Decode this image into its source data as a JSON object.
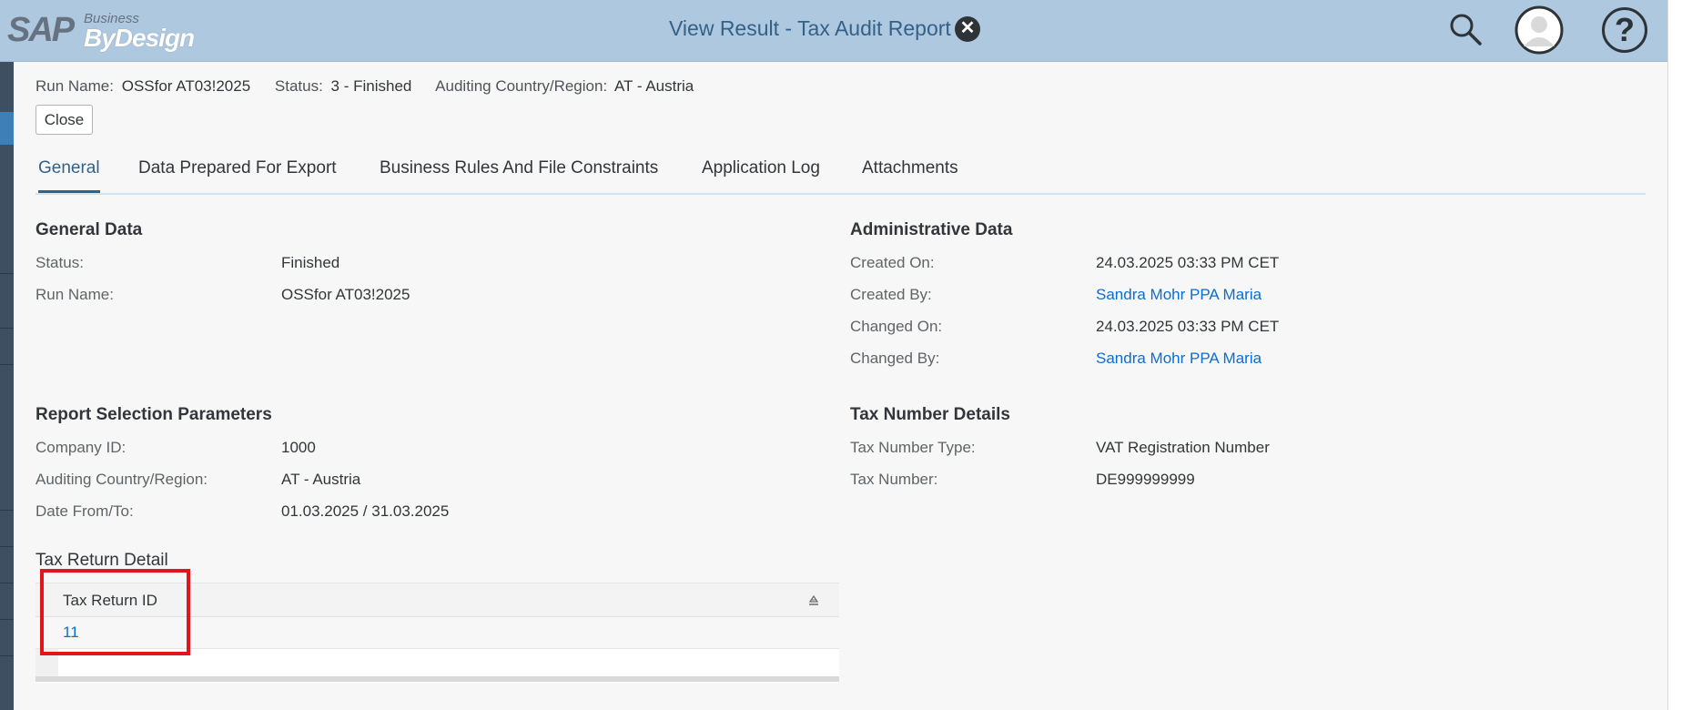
{
  "header": {
    "logo_sap": "SAP",
    "logo_business": "Business",
    "logo_bydesign": "ByDesign",
    "title": "View Result - Tax Audit Report"
  },
  "topinfo": {
    "run_name_label": "Run Name:",
    "run_name_value": "OSSfor AT03!2025",
    "status_label": "Status:",
    "status_value": "3 - Finished",
    "country_label": "Auditing Country/Region:",
    "country_value": "AT - Austria"
  },
  "close_label": "Close",
  "tabs": [
    {
      "label": "General",
      "active": true
    },
    {
      "label": "Data Prepared For Export"
    },
    {
      "label": "Business Rules And File Constraints"
    },
    {
      "label": "Application Log"
    },
    {
      "label": "Attachments"
    }
  ],
  "general_data": {
    "title": "General Data",
    "status_label": "Status:",
    "status_value": "Finished",
    "run_name_label": "Run Name:",
    "run_name_value": "OSSfor AT03!2025"
  },
  "admin_data": {
    "title": "Administrative Data",
    "created_on_label": "Created On:",
    "created_on_value": "24.03.2025 03:33 PM CET",
    "created_by_label": "Created By:",
    "created_by_value": "Sandra Mohr PPA Maria",
    "changed_on_label": "Changed On:",
    "changed_on_value": "24.03.2025 03:33 PM CET",
    "changed_by_label": "Changed By:",
    "changed_by_value": "Sandra Mohr PPA Maria"
  },
  "report_params": {
    "title": "Report Selection Parameters",
    "company_label": "Company ID:",
    "company_value": "1000",
    "country_label": "Auditing Country/Region:",
    "country_value": "AT - Austria",
    "date_label": "Date From/To:",
    "date_value": "01.03.2025 / 31.03.2025"
  },
  "tax_number": {
    "title": "Tax Number Details",
    "type_label": "Tax Number Type:",
    "type_value": "VAT Registration Number",
    "number_label": "Tax Number:",
    "number_value": "DE999999999"
  },
  "tax_return": {
    "title": "Tax Return Detail",
    "column_header": "Tax Return ID",
    "rows": [
      "11"
    ]
  },
  "colors": {
    "header_bg": "#aec8e0",
    "title_color": "#346187",
    "link_color": "#0a6ed1",
    "highlight": "#e0161c"
  }
}
